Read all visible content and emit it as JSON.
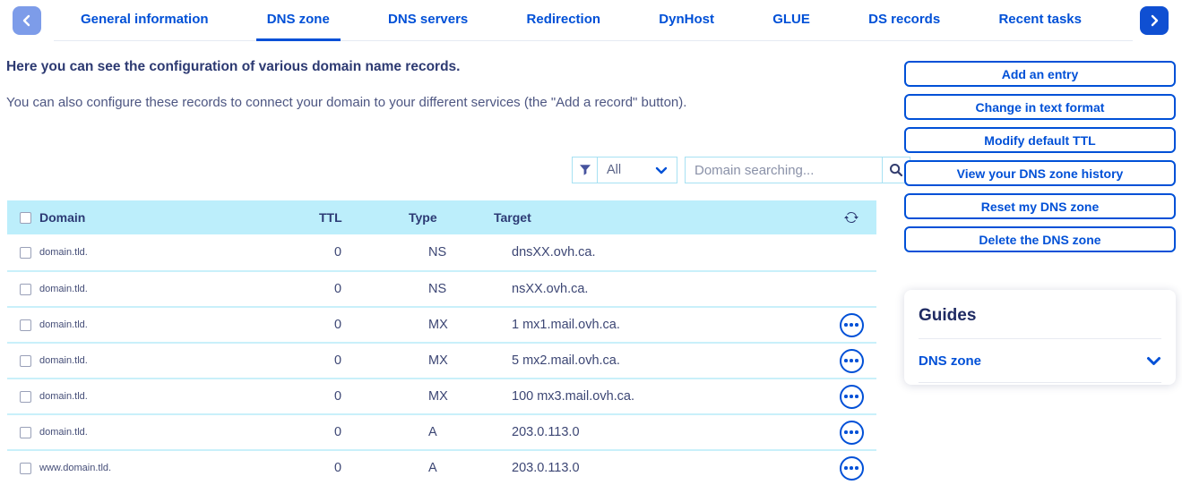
{
  "nav": {
    "prev_icon": "chevron-left-icon",
    "next_icon": "chevron-right-icon"
  },
  "tabs": [
    {
      "label": "General information",
      "active": false
    },
    {
      "label": "DNS zone",
      "active": true
    },
    {
      "label": "DNS servers",
      "active": false
    },
    {
      "label": "Redirection",
      "active": false
    },
    {
      "label": "DynHost",
      "active": false
    },
    {
      "label": "GLUE",
      "active": false
    },
    {
      "label": "DS records",
      "active": false
    },
    {
      "label": "Recent tasks",
      "active": false
    }
  ],
  "intro": {
    "heading": "Here you can see the configuration of various domain name records.",
    "description": "You can also configure these records to connect your domain to your different services (the \"Add a record\" button)."
  },
  "filters": {
    "filter_icon": "funnel-icon",
    "type_filter_value": "All",
    "dropdown_icon": "chevron-down-icon",
    "search_placeholder": "Domain searching...",
    "search_icon": "magnifier-icon"
  },
  "table": {
    "headers": {
      "domain": "Domain",
      "ttl": "TTL",
      "type": "Type",
      "target": "Target"
    },
    "refresh_icon": "refresh-icon",
    "actions_icon": "ellipsis-icon",
    "rows": [
      {
        "domain": "domain.tld.",
        "ttl": "0",
        "type": "NS",
        "target": "dnsXX.ovh.ca.",
        "has_actions": false
      },
      {
        "domain": "domain.tld.",
        "ttl": "0",
        "type": "NS",
        "target": "nsXX.ovh.ca.",
        "has_actions": false
      },
      {
        "domain": "domain.tld.",
        "ttl": "0",
        "type": "MX",
        "target": "1 mx1.mail.ovh.ca.",
        "has_actions": true
      },
      {
        "domain": "domain.tld.",
        "ttl": "0",
        "type": "MX",
        "target": "5 mx2.mail.ovh.ca.",
        "has_actions": true
      },
      {
        "domain": "domain.tld.",
        "ttl": "0",
        "type": "MX",
        "target": "100 mx3.mail.ovh.ca.",
        "has_actions": true
      },
      {
        "domain": "domain.tld.",
        "ttl": "0",
        "type": "A",
        "target": "203.0.113.0",
        "has_actions": true
      },
      {
        "domain": "www.domain.tld.",
        "ttl": "0",
        "type": "A",
        "target": "203.0.113.0",
        "has_actions": true
      }
    ]
  },
  "actions": [
    "Add an entry",
    "Change in text format",
    "Modify default TTL",
    "View your DNS zone history",
    "Reset my DNS zone",
    "Delete the DNS zone"
  ],
  "guides": {
    "title": "Guides",
    "links": [
      {
        "label": "DNS zone",
        "icon": "chevron-down-icon"
      }
    ]
  },
  "colors": {
    "accent": "#0050d7",
    "table_header_bg": "#bceefb",
    "row_divider": "#c9f0fa",
    "nav_prev_bg": "#7d9ce9",
    "nav_next_bg": "#0f4fd2",
    "heading_text": "#2d3a72",
    "body_text": "#4d5682"
  }
}
